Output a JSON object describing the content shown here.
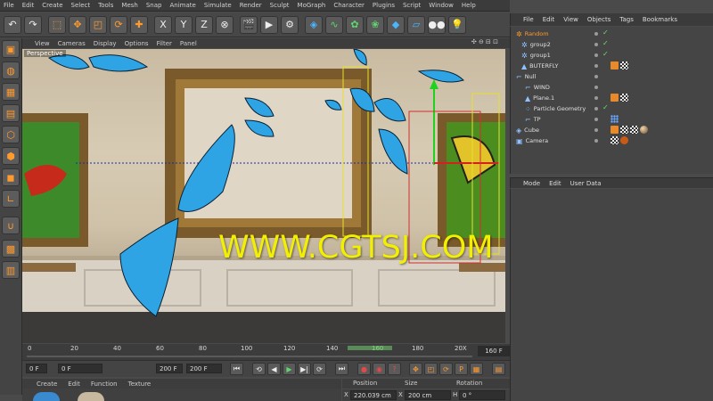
{
  "menubar": [
    "File",
    "Edit",
    "Create",
    "Select",
    "Tools",
    "Mesh",
    "Snap",
    "Animate",
    "Simulate",
    "Render",
    "Sculpt",
    "MoGraph",
    "Character",
    "Plugins",
    "Script",
    "Window",
    "Help"
  ],
  "toolbar": {
    "coord_x": "X",
    "coord_y": "Y",
    "coord_z": "Z"
  },
  "viewport": {
    "menu": [
      "View",
      "Cameras",
      "Display",
      "Options",
      "Filter",
      "Panel"
    ],
    "label": "Perspective",
    "controls": "✣ ⊖ ⊟ ⊡"
  },
  "watermark": "WWW.CGTSJ.COM",
  "timeline": {
    "ticks": [
      "0",
      "20",
      "40",
      "60",
      "80",
      "100",
      "120",
      "140",
      "160",
      "180",
      "20X"
    ],
    "current_marker": "160",
    "frame_field": "160 F"
  },
  "transport": {
    "start_field": "0 F",
    "min_field": "0 F",
    "end_field": "200 F",
    "max_field": "200 F"
  },
  "material_manager": {
    "menu": [
      "Create",
      "Edit",
      "Function",
      "Texture"
    ]
  },
  "coordinates": {
    "headers": [
      "Position",
      "Size",
      "Rotation"
    ],
    "axis": "X",
    "position": "220.039 cm",
    "size": "200 cm",
    "rotation_axis": "H",
    "rotation": "0 °"
  },
  "object_manager": {
    "menu": [
      "File",
      "Edit",
      "View",
      "Objects",
      "Tags",
      "Bookmarks"
    ],
    "objects": [
      {
        "name": "Random",
        "indent": 0,
        "highlight": true,
        "icon": "random-icon"
      },
      {
        "name": "group2",
        "indent": 1,
        "icon": "group-icon"
      },
      {
        "name": "group1",
        "indent": 1,
        "icon": "group-icon"
      },
      {
        "name": "BUTERFLY",
        "indent": 1,
        "icon": "polygon-icon"
      },
      {
        "name": "Null",
        "indent": 0,
        "icon": "null-icon"
      },
      {
        "name": "WIND",
        "indent": 1,
        "icon": "wind-icon"
      },
      {
        "name": "Plane.1",
        "indent": 1,
        "icon": "plane-icon"
      },
      {
        "name": "Particle Geometry",
        "indent": 1,
        "icon": "particle-icon"
      },
      {
        "name": "TP",
        "indent": 1,
        "icon": "tp-icon"
      },
      {
        "name": "Cube",
        "indent": 0,
        "icon": "cube-icon"
      },
      {
        "name": "Camera",
        "indent": 0,
        "icon": "camera-icon"
      }
    ]
  },
  "attributes": {
    "menu": [
      "Mode",
      "Edit",
      "User Data"
    ]
  },
  "colors": {
    "accent_orange": "#ff9a2e",
    "watermark": "#f2f000",
    "butterfly_blue": "#2fa4e4",
    "selected_object": "#ff9a2e"
  }
}
